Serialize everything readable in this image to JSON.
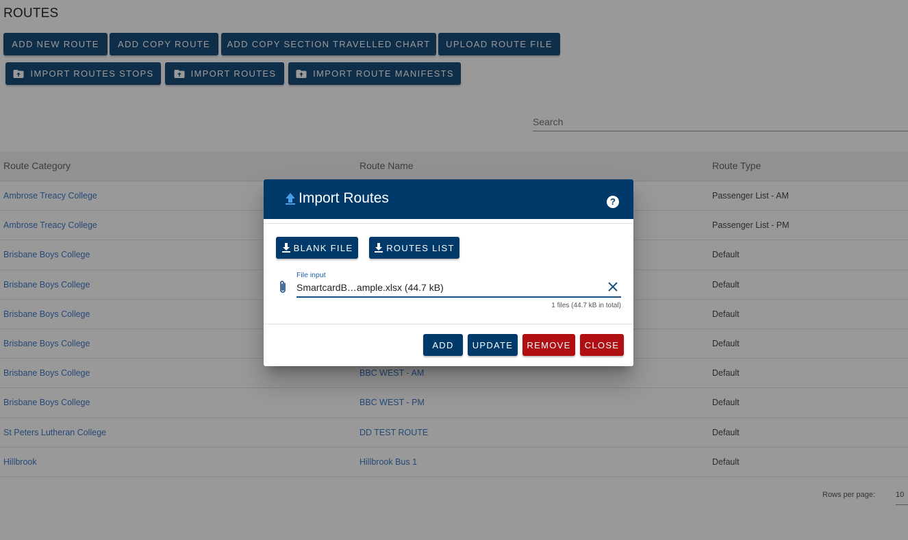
{
  "page": {
    "title": "ROUTES"
  },
  "toolbar": {
    "add_new_route": "ADD NEW ROUTE",
    "add_copy_route": "ADD COPY ROUTE",
    "add_copy_section": "ADD COPY SECTION TRAVELLED CHART",
    "upload_route_file": "UPLOAD ROUTE FILE",
    "import_routes_stops": "IMPORT ROUTES STOPS",
    "import_routes": "IMPORT ROUTES",
    "import_route_manifests": "IMPORT ROUTE MANIFESTS"
  },
  "search": {
    "placeholder": "Search"
  },
  "table": {
    "headers": [
      "Route Category",
      "Route Name",
      "Route Type"
    ],
    "rows": [
      [
        "Ambrose Treacy College",
        "",
        "Passenger List - AM"
      ],
      [
        "Ambrose Treacy College",
        "",
        "Passenger List - PM"
      ],
      [
        "Brisbane Boys College",
        "",
        "Default"
      ],
      [
        "Brisbane Boys College",
        "",
        "Default"
      ],
      [
        "Brisbane Boys College",
        "",
        "Default"
      ],
      [
        "Brisbane Boys College",
        "",
        "Default"
      ],
      [
        "Brisbane Boys College",
        "BBC WEST - AM",
        "Default"
      ],
      [
        "Brisbane Boys College",
        "BBC WEST - PM",
        "Default"
      ],
      [
        "St Peters Lutheran College",
        "DD TEST ROUTE",
        "Default"
      ],
      [
        "Hillbrook",
        "Hillbrook Bus 1",
        "Default"
      ]
    ]
  },
  "footer": {
    "rows_per_page_label": "Rows per page:",
    "rows_per_page_value": "10"
  },
  "dialog": {
    "title": "Import Routes",
    "help": "?",
    "blank_file": "BLANK FILE",
    "routes_list": "ROUTES LIST",
    "file_label": "File input",
    "file_value": "SmartcardB…ample.xlsx (44.7 kB)",
    "file_count": "1 files (44.7 kB in total)",
    "add": "ADD",
    "update": "UPDATE",
    "remove": "REMOVE",
    "close": "CLOSE"
  },
  "colors": {
    "primary": "#003a6b",
    "danger": "#b00f14",
    "link": "#2a6cc0"
  }
}
